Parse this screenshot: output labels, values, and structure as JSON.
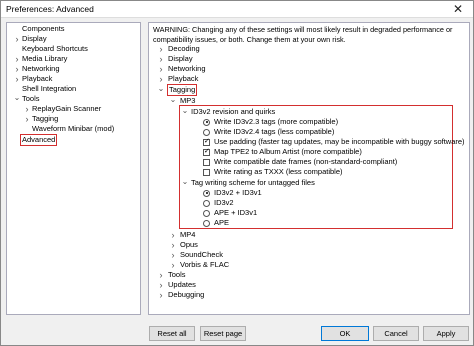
{
  "window": {
    "title": "Preferences: Advanced",
    "close_glyph": "✕"
  },
  "tree": {
    "items": [
      {
        "label": "Components"
      },
      {
        "label": "Display"
      },
      {
        "label": "Keyboard Shortcuts"
      },
      {
        "label": "Media Library"
      },
      {
        "label": "Networking"
      },
      {
        "label": "Playback"
      },
      {
        "label": "Shell Integration"
      },
      {
        "label": "Tools"
      },
      {
        "label": "ReplayGain Scanner"
      },
      {
        "label": "Tagging"
      },
      {
        "label": "Waveform Minibar (mod)"
      },
      {
        "label": "Advanced"
      }
    ]
  },
  "panel": {
    "warning": "WARNING: Changing any of these settings will most likely result in degraded performance or compatibility issues, or both. Change them at your own risk.",
    "nodes": {
      "decoding": "Decoding",
      "display": "Display",
      "networking": "Networking",
      "playback": "Playback",
      "tagging": "Tagging",
      "mp3": "MP3",
      "id3v2_group": "ID3v2 revision and quirks",
      "write_23": "Write ID3v2.3 tags (more compatible)",
      "write_24": "Write ID3v2.4 tags (less compatible)",
      "use_padding": "Use padding (faster tag updates, may be incompatible with buggy software)",
      "map_tpe2": "Map TPE2 to Album Artist (more compatible)",
      "write_date": "Write compatible date frames (non-standard-compliant)",
      "write_rating": "Write rating as TXXX (less compatible)",
      "scheme_group": "Tag writing scheme for untagged files",
      "scheme_1": "ID3v2 + ID3v1",
      "scheme_2": "ID3v2",
      "scheme_3": "APE + ID3v1",
      "scheme_4": "APE",
      "mp4": "MP4",
      "opus": "Opus",
      "soundcheck": "SoundCheck",
      "vorbis": "Vorbis & FLAC",
      "tools": "Tools",
      "updates": "Updates",
      "debugging": "Debugging"
    }
  },
  "buttons": {
    "reset_all": "Reset all",
    "reset_page": "Reset page",
    "ok": "OK",
    "cancel": "Cancel",
    "apply": "Apply"
  },
  "colors": {
    "highlight": "#d32f2f"
  }
}
